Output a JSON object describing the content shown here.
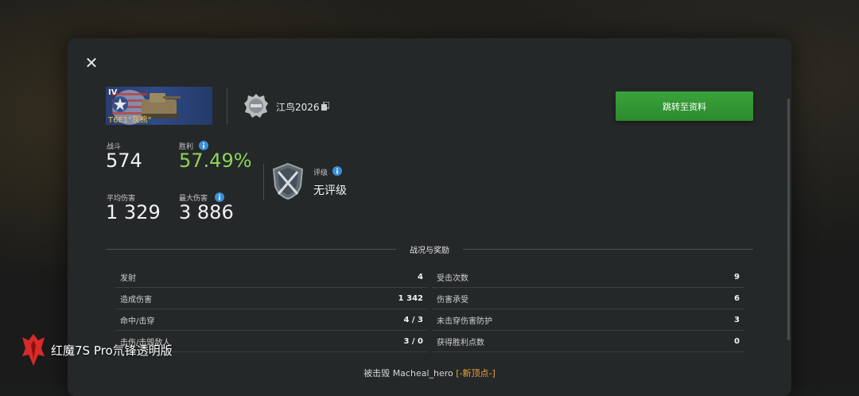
{
  "header": {
    "close_label": "✕"
  },
  "tank": {
    "tier": "IV",
    "name": "T6E1\"灰熊\""
  },
  "player": {
    "name": "江鸟2026"
  },
  "actions": {
    "profile_button": "跳转至资料"
  },
  "stats": {
    "battles_label": "战斗",
    "battles_value": "574",
    "wins_label": "胜利",
    "wins_value": "57.49%",
    "avg_damage_label": "平均伤害",
    "avg_damage_value": "1 329",
    "max_damage_label": "最大伤害",
    "max_damage_value": "3 886",
    "rating_label": "评级",
    "rating_value": "无评级"
  },
  "section": {
    "title": "战况与奖励",
    "left_rows": [
      {
        "label": "发射",
        "value": "4"
      },
      {
        "label": "造成伤害",
        "value": "1 342"
      },
      {
        "label": "命中/击穿",
        "value": "4 / 3"
      },
      {
        "label": "击伤/击毁敌人",
        "value": "3 / 0"
      }
    ],
    "right_rows": [
      {
        "label": "受击次数",
        "value": "9"
      },
      {
        "label": "伤害承受",
        "value": "6"
      },
      {
        "label": "未击穿伤害防护",
        "value": "3"
      },
      {
        "label": "获得胜利点数",
        "value": "0"
      }
    ]
  },
  "footer": {
    "destroyed_by_prefix": "被击毁",
    "destroyer_name": "Macheal_hero",
    "destroyer_tag": "[-新顶点-]"
  },
  "watermark": {
    "text": "红魔7S Pro氘锋透明版"
  },
  "colors": {
    "accent_green": "#3aa33a",
    "win_rate_green": "#8ed35a",
    "info_blue": "#3b8fd6",
    "clan_tag_orange": "#f0a338",
    "tank_name_gold": "#f0c94a"
  },
  "icons": [
    "close-icon",
    "tank-flag-icon",
    "clan-emblem-icon",
    "copy-icon",
    "info-icon",
    "rating-shield-icon",
    "brand-logo-icon"
  ]
}
